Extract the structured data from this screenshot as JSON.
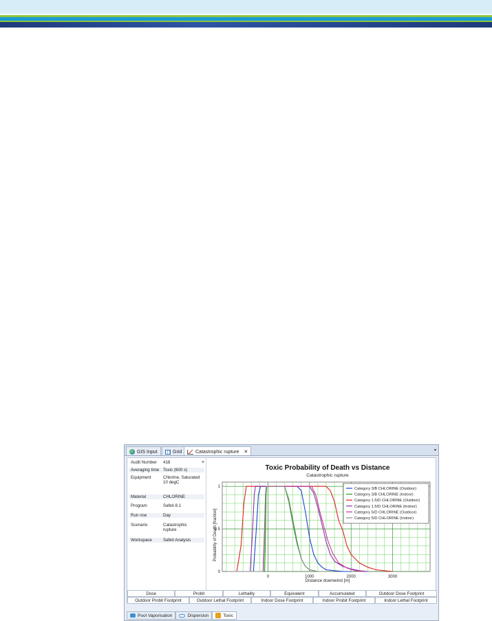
{
  "colors": {
    "sky": "#d7eef9",
    "green": "#8cc63f",
    "teal": "#1b9ad6",
    "navy": "#1e3a7a"
  },
  "tabs": [
    {
      "label": "GIS Input",
      "icon": "globe-icon"
    },
    {
      "label": "Grid",
      "icon": "grid-icon"
    },
    {
      "label": "Catastrophic rupture",
      "icon": "chart-icon",
      "close": "✕"
    }
  ],
  "properties": [
    {
      "key": "Audit Number",
      "value": "418"
    },
    {
      "key": "Averaging time",
      "value": "Toxic (600 s)"
    },
    {
      "key": "Equipment",
      "value": "Chlorine, Saturated 10 degC"
    },
    {
      "key": "Material",
      "value": "CHLORINE"
    },
    {
      "key": "Program",
      "value": "Safeti 8.1"
    },
    {
      "key": "Run row",
      "value": "Day"
    },
    {
      "key": "Scenario",
      "value": "Catastrophic rupture"
    },
    {
      "key": "Workspace",
      "value": "Safeti Analysis"
    }
  ],
  "props_close": "×",
  "chart_data": {
    "type": "line",
    "title": "Toxic Probability of Death vs Distance",
    "subtitle": "Catastrophic rupture",
    "xlabel": "Distance downwind [m]",
    "ylabel": "Probability of Death [fraction]",
    "xlim": [
      -1100,
      3900
    ],
    "ylim": [
      0,
      1.05
    ],
    "xticks": [
      0,
      1000,
      2000,
      3000
    ],
    "yticks": [
      0,
      0.5,
      1
    ],
    "ytick_labels": [
      "0",
      "0.5",
      "1"
    ],
    "grid": true,
    "legend_position": "top-right",
    "series": [
      {
        "name": "Category 3/B CHLORINE (Outdoor)",
        "color": "#1f3fd0",
        "x": [
          -1000,
          -350,
          -280,
          -230,
          -180,
          700,
          800,
          900,
          1000,
          1100,
          1200,
          1300,
          1400,
          1600,
          1800,
          2000
        ],
        "y": [
          0,
          0,
          0.5,
          0.9,
          1,
          1,
          0.95,
          0.7,
          0.4,
          0.2,
          0.1,
          0.05,
          0.02,
          0.01,
          0,
          0
        ]
      },
      {
        "name": "Category 3/B CHLORINE (Indoor)",
        "color": "#2a9a2a",
        "x": [
          -1000,
          -80,
          -60,
          -45,
          -30,
          400,
          500,
          600,
          700,
          800,
          900,
          1000,
          1200,
          1400
        ],
        "y": [
          0,
          0,
          0.4,
          0.9,
          1,
          1,
          0.85,
          0.6,
          0.35,
          0.15,
          0.06,
          0.02,
          0,
          0
        ]
      },
      {
        "name": "Category 1.5/D CHLORINE (Outdoor)",
        "color": "#e02020",
        "x": [
          -1000,
          -750,
          -650,
          -580,
          -520,
          1400,
          1500,
          1600,
          1700,
          1800,
          1900,
          2000,
          2200,
          2400,
          2600,
          2800,
          3000
        ],
        "y": [
          0,
          0,
          0.3,
          0.8,
          1,
          1,
          0.95,
          0.82,
          0.6,
          0.48,
          0.3,
          0.2,
          0.1,
          0.05,
          0.02,
          0.01,
          0
        ]
      },
      {
        "name": "Category 1.5/D CHLORINE (Indoor)",
        "color": "#8b2fb0",
        "x": [
          -1000,
          -430,
          -380,
          -330,
          -300,
          1000,
          1100,
          1200,
          1300,
          1400,
          1500,
          1600,
          1800,
          2000,
          2200,
          2400
        ],
        "y": [
          0,
          0,
          0.4,
          0.9,
          1,
          1,
          0.92,
          0.75,
          0.55,
          0.35,
          0.2,
          0.12,
          0.06,
          0.03,
          0.01,
          0
        ]
      },
      {
        "name": "Category 5/D CHLORINE (Outdoor)",
        "color": "#cc3399",
        "x": [
          -1000,
          -120,
          -90,
          -60,
          -40,
          1050,
          1150,
          1250,
          1350,
          1450,
          1550,
          1700,
          1900,
          2100,
          2300
        ],
        "y": [
          0,
          0,
          0.4,
          0.9,
          1,
          1,
          0.9,
          0.7,
          0.52,
          0.35,
          0.22,
          0.1,
          0.04,
          0.01,
          0
        ]
      },
      {
        "name": "Category 5/D CHLORINE (Indoor)",
        "color": "#8a8a8a",
        "x": [
          -1000,
          -110,
          -80,
          -60,
          -40,
          400,
          500,
          600,
          700,
          800,
          900,
          1000,
          1200,
          1400
        ],
        "y": [
          0,
          0,
          0.4,
          0.9,
          1,
          1,
          0.82,
          0.55,
          0.32,
          0.15,
          0.06,
          0.02,
          0,
          0
        ]
      }
    ]
  },
  "button_row1": [
    "Dose",
    "Probit",
    "Lethality",
    "Equivalent",
    "Accumulated",
    "Outdoor Dose Footprint"
  ],
  "button_row2": [
    "Outdoor Probit Footprint",
    "Outdoor Lethal Footprint",
    "Indoor Dose Footprint",
    "Indoor Probit Footprint",
    "Indoor Lethal Footprint"
  ],
  "bottom_tabs": [
    {
      "label": "Pool Vaporisation",
      "icon": "pool-icon"
    },
    {
      "label": "Dispersion",
      "icon": "cloud-icon"
    },
    {
      "label": "Toxic",
      "icon": "toxic-icon"
    }
  ],
  "dropdown_glyph": "▾"
}
